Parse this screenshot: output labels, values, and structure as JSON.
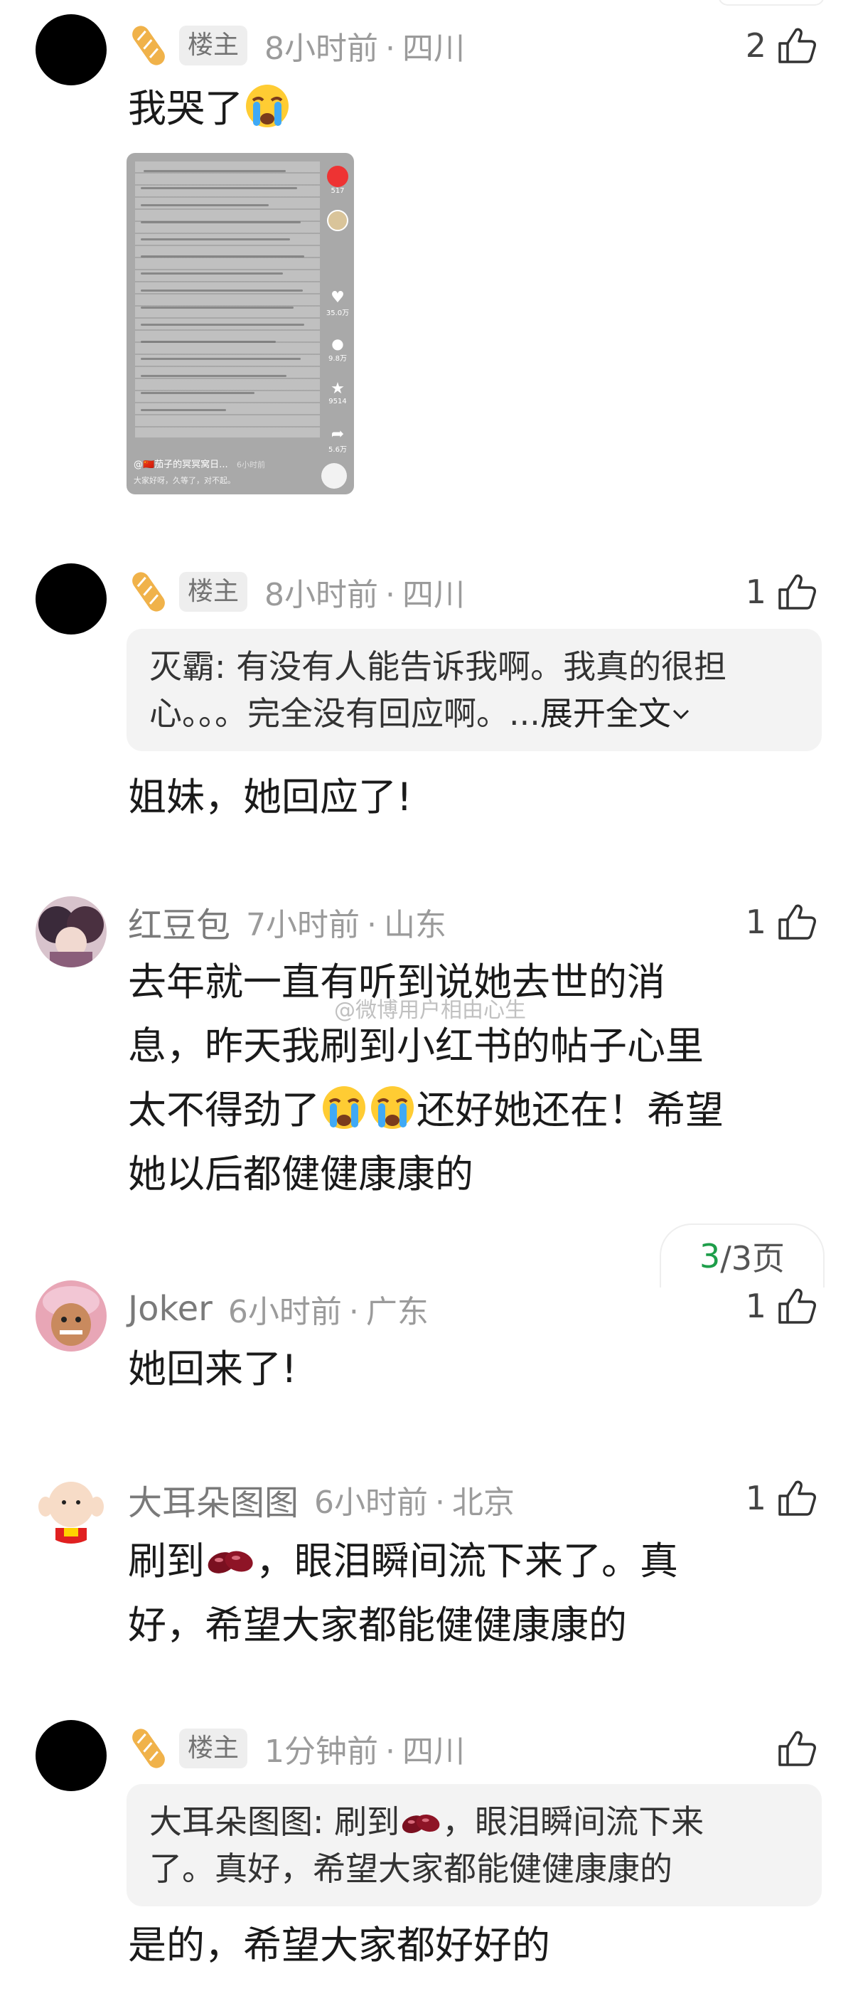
{
  "page_number": {
    "current": "3",
    "rest": "/3页"
  },
  "watermark": "@微博用户相由心生",
  "comments": [
    {
      "badge": "楼主",
      "time": "8小时前",
      "location": "四川",
      "likes": "2",
      "text": "我哭了",
      "thumbnail": {
        "counts": [
          "517",
          "35.0万",
          "9.8万",
          "9514",
          "5.6万"
        ],
        "caption": "@🇨🇳茄子的冥冥窝日...",
        "time": "6小时前",
        "caption2": "大家好呀，久等了，对不起。"
      }
    },
    {
      "badge": "楼主",
      "time": "8小时前",
      "location": "四川",
      "likes": "1",
      "quote_line1": "灭霸: 有没有人能告诉我啊。我真的很担",
      "quote_line2": "心。。。完全没有回应啊。...",
      "expand_label": "展开全文",
      "text": "姐妹，她回应了!"
    },
    {
      "name": "红豆包",
      "time": "7小时前",
      "location": "山东",
      "likes": "1",
      "line1": "去年就一直有听到说她去世的消",
      "line2": "息，昨天我刷到小红书的帖子心里",
      "line3a": "太不得劲了",
      "line3b": "还好她还在！希望",
      "line4": "她以后都健健康康的"
    },
    {
      "name": "Joker",
      "time": "6小时前",
      "location": "广东",
      "likes": "1",
      "text": "她回来了!"
    },
    {
      "name": "大耳朵图图",
      "time": "6小时前",
      "location": "北京",
      "likes": "1",
      "line1a": "刷到",
      "line1b": "，眼泪瞬间流下来了。真",
      "line2": "好，希望大家都能健健康康的"
    },
    {
      "badge": "楼主",
      "time": "1分钟前",
      "location": "四川",
      "quote_name": "大耳朵图图:",
      "quote_a": " 刷到",
      "quote_b": "，眼泪瞬间流下来",
      "quote_line2": "了。真好，希望大家都能健健康康的",
      "text": "是的，希望大家都好好的"
    }
  ],
  "colors": {
    "page_highlight": "#1e9e4a",
    "meta_gray": "#9b9b9b",
    "quote_bg": "#f3f3f3"
  },
  "icons": [
    "bread-icon",
    "thumb-up-icon",
    "crying-emoji",
    "red-bean-emoji",
    "chevron-down-icon"
  ]
}
